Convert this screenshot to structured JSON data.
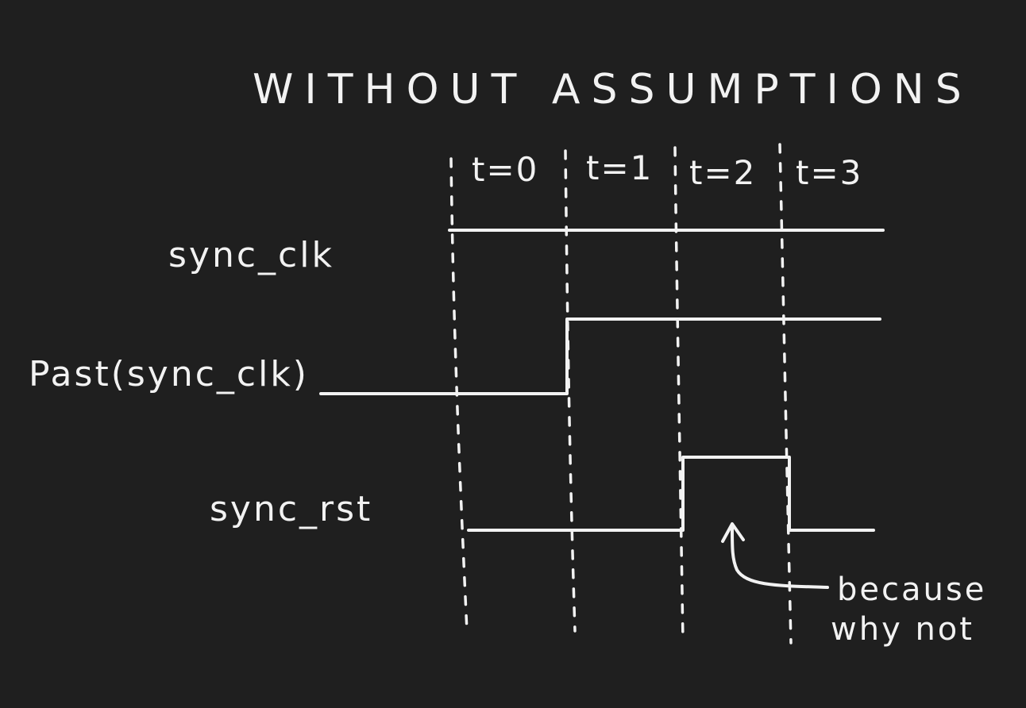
{
  "title": "WITHOUT ASSUMPTIONS",
  "time_steps": [
    "t=0",
    "t=1",
    "t=2",
    "t=3"
  ],
  "signals": [
    {
      "label": "sync_clk",
      "levels": [
        1,
        1,
        1,
        1
      ]
    },
    {
      "label": "Past(sync_clk)",
      "levels": [
        0,
        1,
        1,
        1
      ]
    },
    {
      "label": "sync_rst",
      "levels": [
        0,
        0,
        1,
        0
      ]
    }
  ],
  "annotation": {
    "line1": "because",
    "line2": "why not"
  },
  "colors": {
    "background": "#1f1f1f",
    "ink": "#f2f2f2"
  }
}
